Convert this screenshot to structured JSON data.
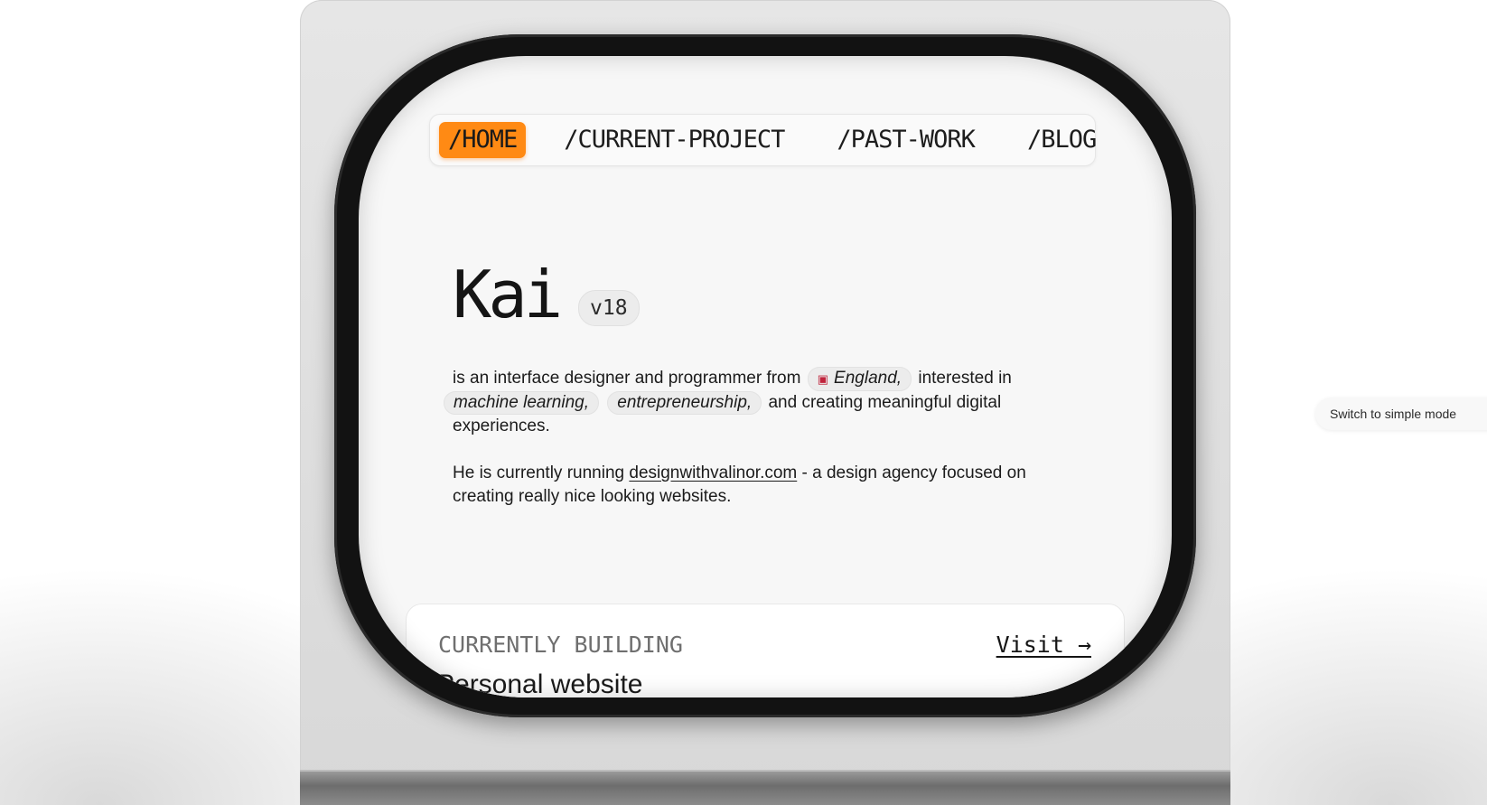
{
  "nav": {
    "items": [
      {
        "label": "/HOME",
        "active": true
      },
      {
        "label": "/CURRENT-PROJECT",
        "active": false
      },
      {
        "label": "/PAST-WORK",
        "active": false
      },
      {
        "label": "/BLOG",
        "active": false
      }
    ]
  },
  "hero": {
    "name": "Kai",
    "version": "v18"
  },
  "bio": {
    "intro_text": "is an interface designer and programmer from",
    "location_tag": "England,",
    "interested_text": "interested in",
    "interest_tag_1": "machine learning,",
    "interest_tag_2": "entrepreneurship,",
    "closing_text": "and creating meaningful digital experiences.",
    "running_prefix": "He is currently running",
    "agency_link": "designwithvalinor.com",
    "running_suffix": "- a design agency focused on creating really nice looking websites."
  },
  "card": {
    "label": "CURRENTLY BUILDING",
    "visit_label": "Visit →",
    "title": "Personal website"
  },
  "switch_mode_label": "Switch to simple mode",
  "colors": {
    "accent": "#ff8a14",
    "screen_bg": "#f7f7f7",
    "bezel": "#121212"
  }
}
